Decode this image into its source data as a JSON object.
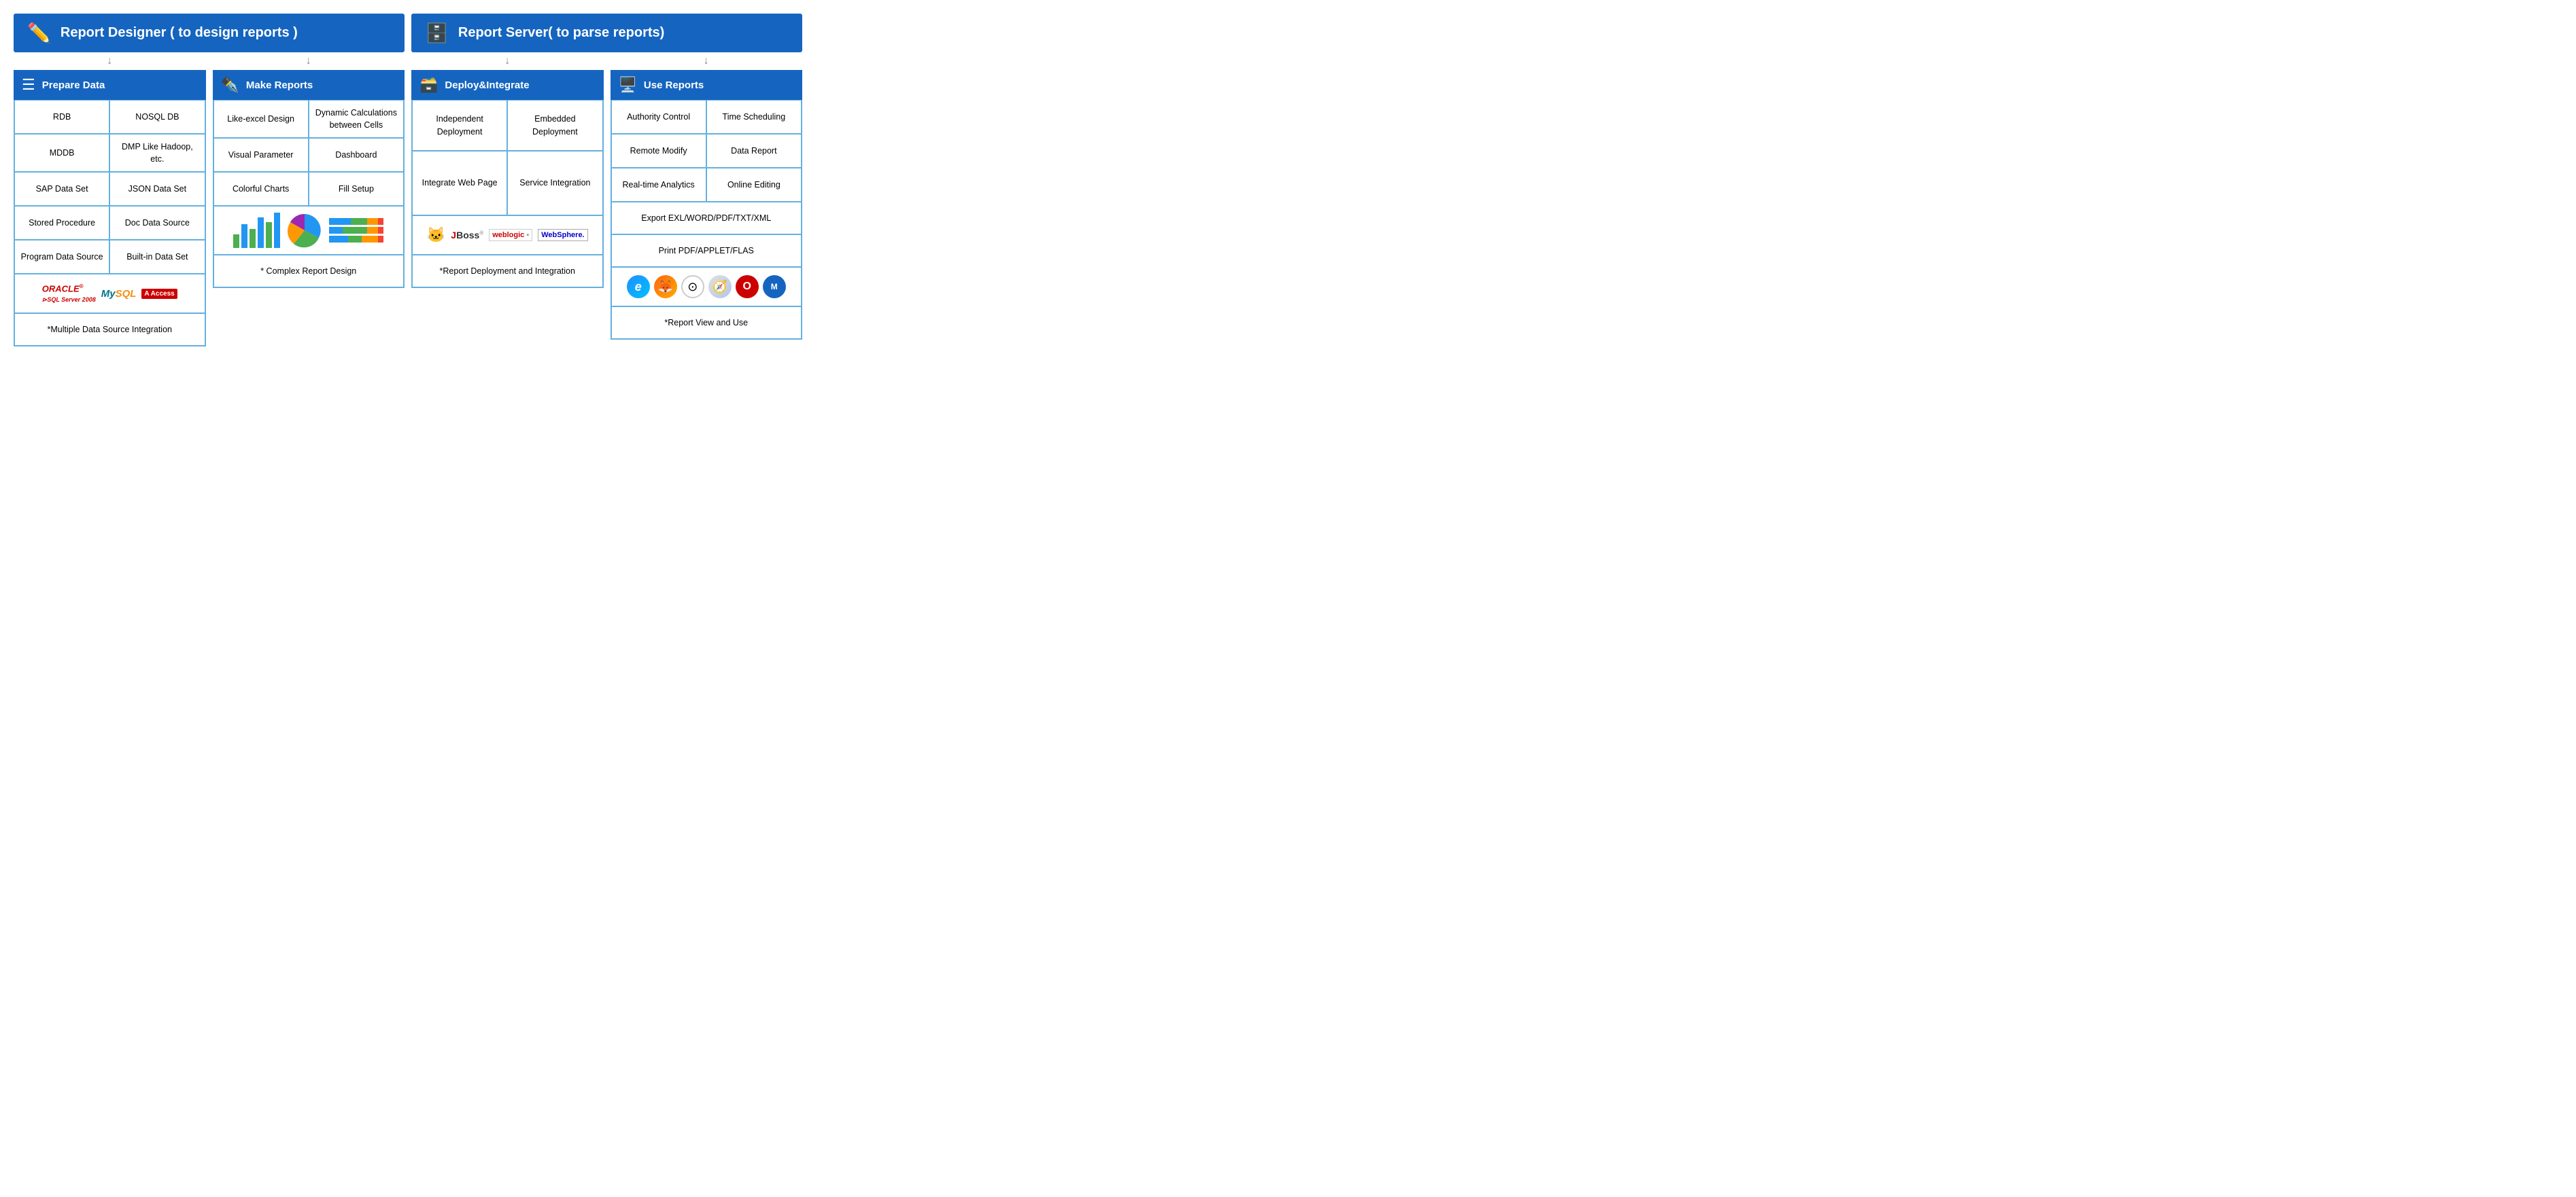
{
  "headers": {
    "left": {
      "label": "Report Designer ( to design reports )",
      "icon": "pencil"
    },
    "right": {
      "label": "Report Server( to parse reports)",
      "icon": "server"
    }
  },
  "sections": [
    {
      "id": "prepare-data",
      "title": "Prepare Data",
      "icon": "list",
      "grid": [
        [
          "RDB",
          "NOSQL DB"
        ],
        [
          "MDDB",
          "DMP Like Hadoop, etc."
        ],
        [
          "SAP Data Set",
          "JSON Data Set"
        ],
        [
          "Stored Procedure",
          "Doc Data Source"
        ],
        [
          "Program Data Source",
          "Built-in Data Set"
        ]
      ],
      "logos_label": "oracle mysql access sqlserver",
      "bottom_note": "*Multiple Data Source Integration"
    },
    {
      "id": "make-reports",
      "title": "Make Reports",
      "icon": "edit",
      "grid": [
        [
          "Like-excel Design",
          "Dynamic Calculations between Cells"
        ],
        [
          "Visual Parameter",
          "Dashboard"
        ],
        [
          "Colorful Charts",
          "Fill Setup"
        ]
      ],
      "has_chart": true,
      "bottom_note": "* Complex Report Design"
    },
    {
      "id": "deploy-integrate",
      "title": "Deploy&Integrate",
      "icon": "database",
      "grid": [
        [
          "Independent Deployment",
          "Embedded Deployment"
        ],
        [
          "Integrate Web Page",
          "Service Integration"
        ]
      ],
      "has_server_logos": true,
      "bottom_note": "*Report Deployment and Integration"
    },
    {
      "id": "use-reports",
      "title": "Use Reports",
      "icon": "monitor",
      "grid_single": [
        [
          "Authority Control",
          "Time Scheduling"
        ],
        [
          "Remote Modify",
          "Data Report"
        ],
        [
          "Real-time Analytics",
          "Online Editing"
        ]
      ],
      "full_rows": [
        "Export EXL/WORD/PDF/TXT/XML",
        "Print PDF/APPLET/FLAS"
      ],
      "has_browsers": true,
      "bottom_note": "*Report View and Use"
    }
  ]
}
